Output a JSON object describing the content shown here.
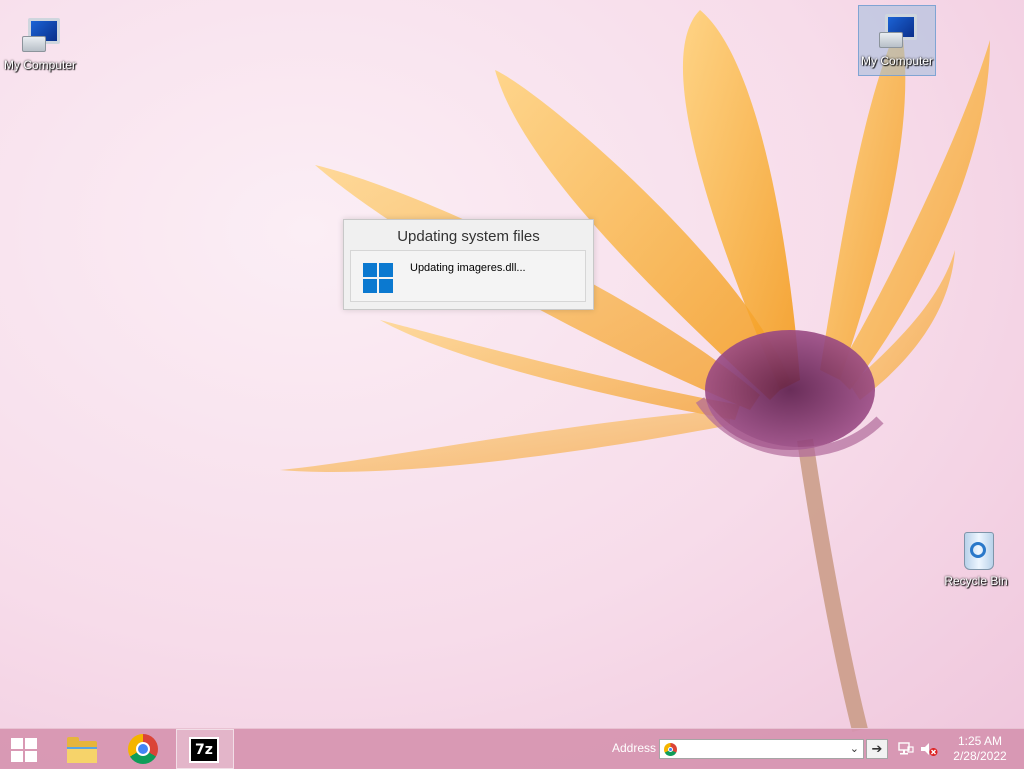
{
  "desktop": {
    "icons": [
      {
        "label": "My Computer"
      },
      {
        "label": "My Computer"
      },
      {
        "label": "Recycle Bin"
      }
    ]
  },
  "dialog": {
    "title": "Updating system files",
    "message": "Updating imageres.dll..."
  },
  "taskbar": {
    "address_label": "Address",
    "address_value": "",
    "go_glyph": "➔",
    "dropdown_glyph": "⌄",
    "seven_zip_text": "7z",
    "time": "1:25 AM",
    "date": "2/28/2022"
  },
  "colors": {
    "accent_windows_blue": "#0b79d0",
    "petal_orange": "#f6a623",
    "flower_center_purple": "#7a2d63"
  },
  "icons": [
    "windows-start-icon",
    "file-explorer-icon",
    "chrome-icon",
    "7zip-icon",
    "network-icon",
    "volume-muted-icon"
  ]
}
